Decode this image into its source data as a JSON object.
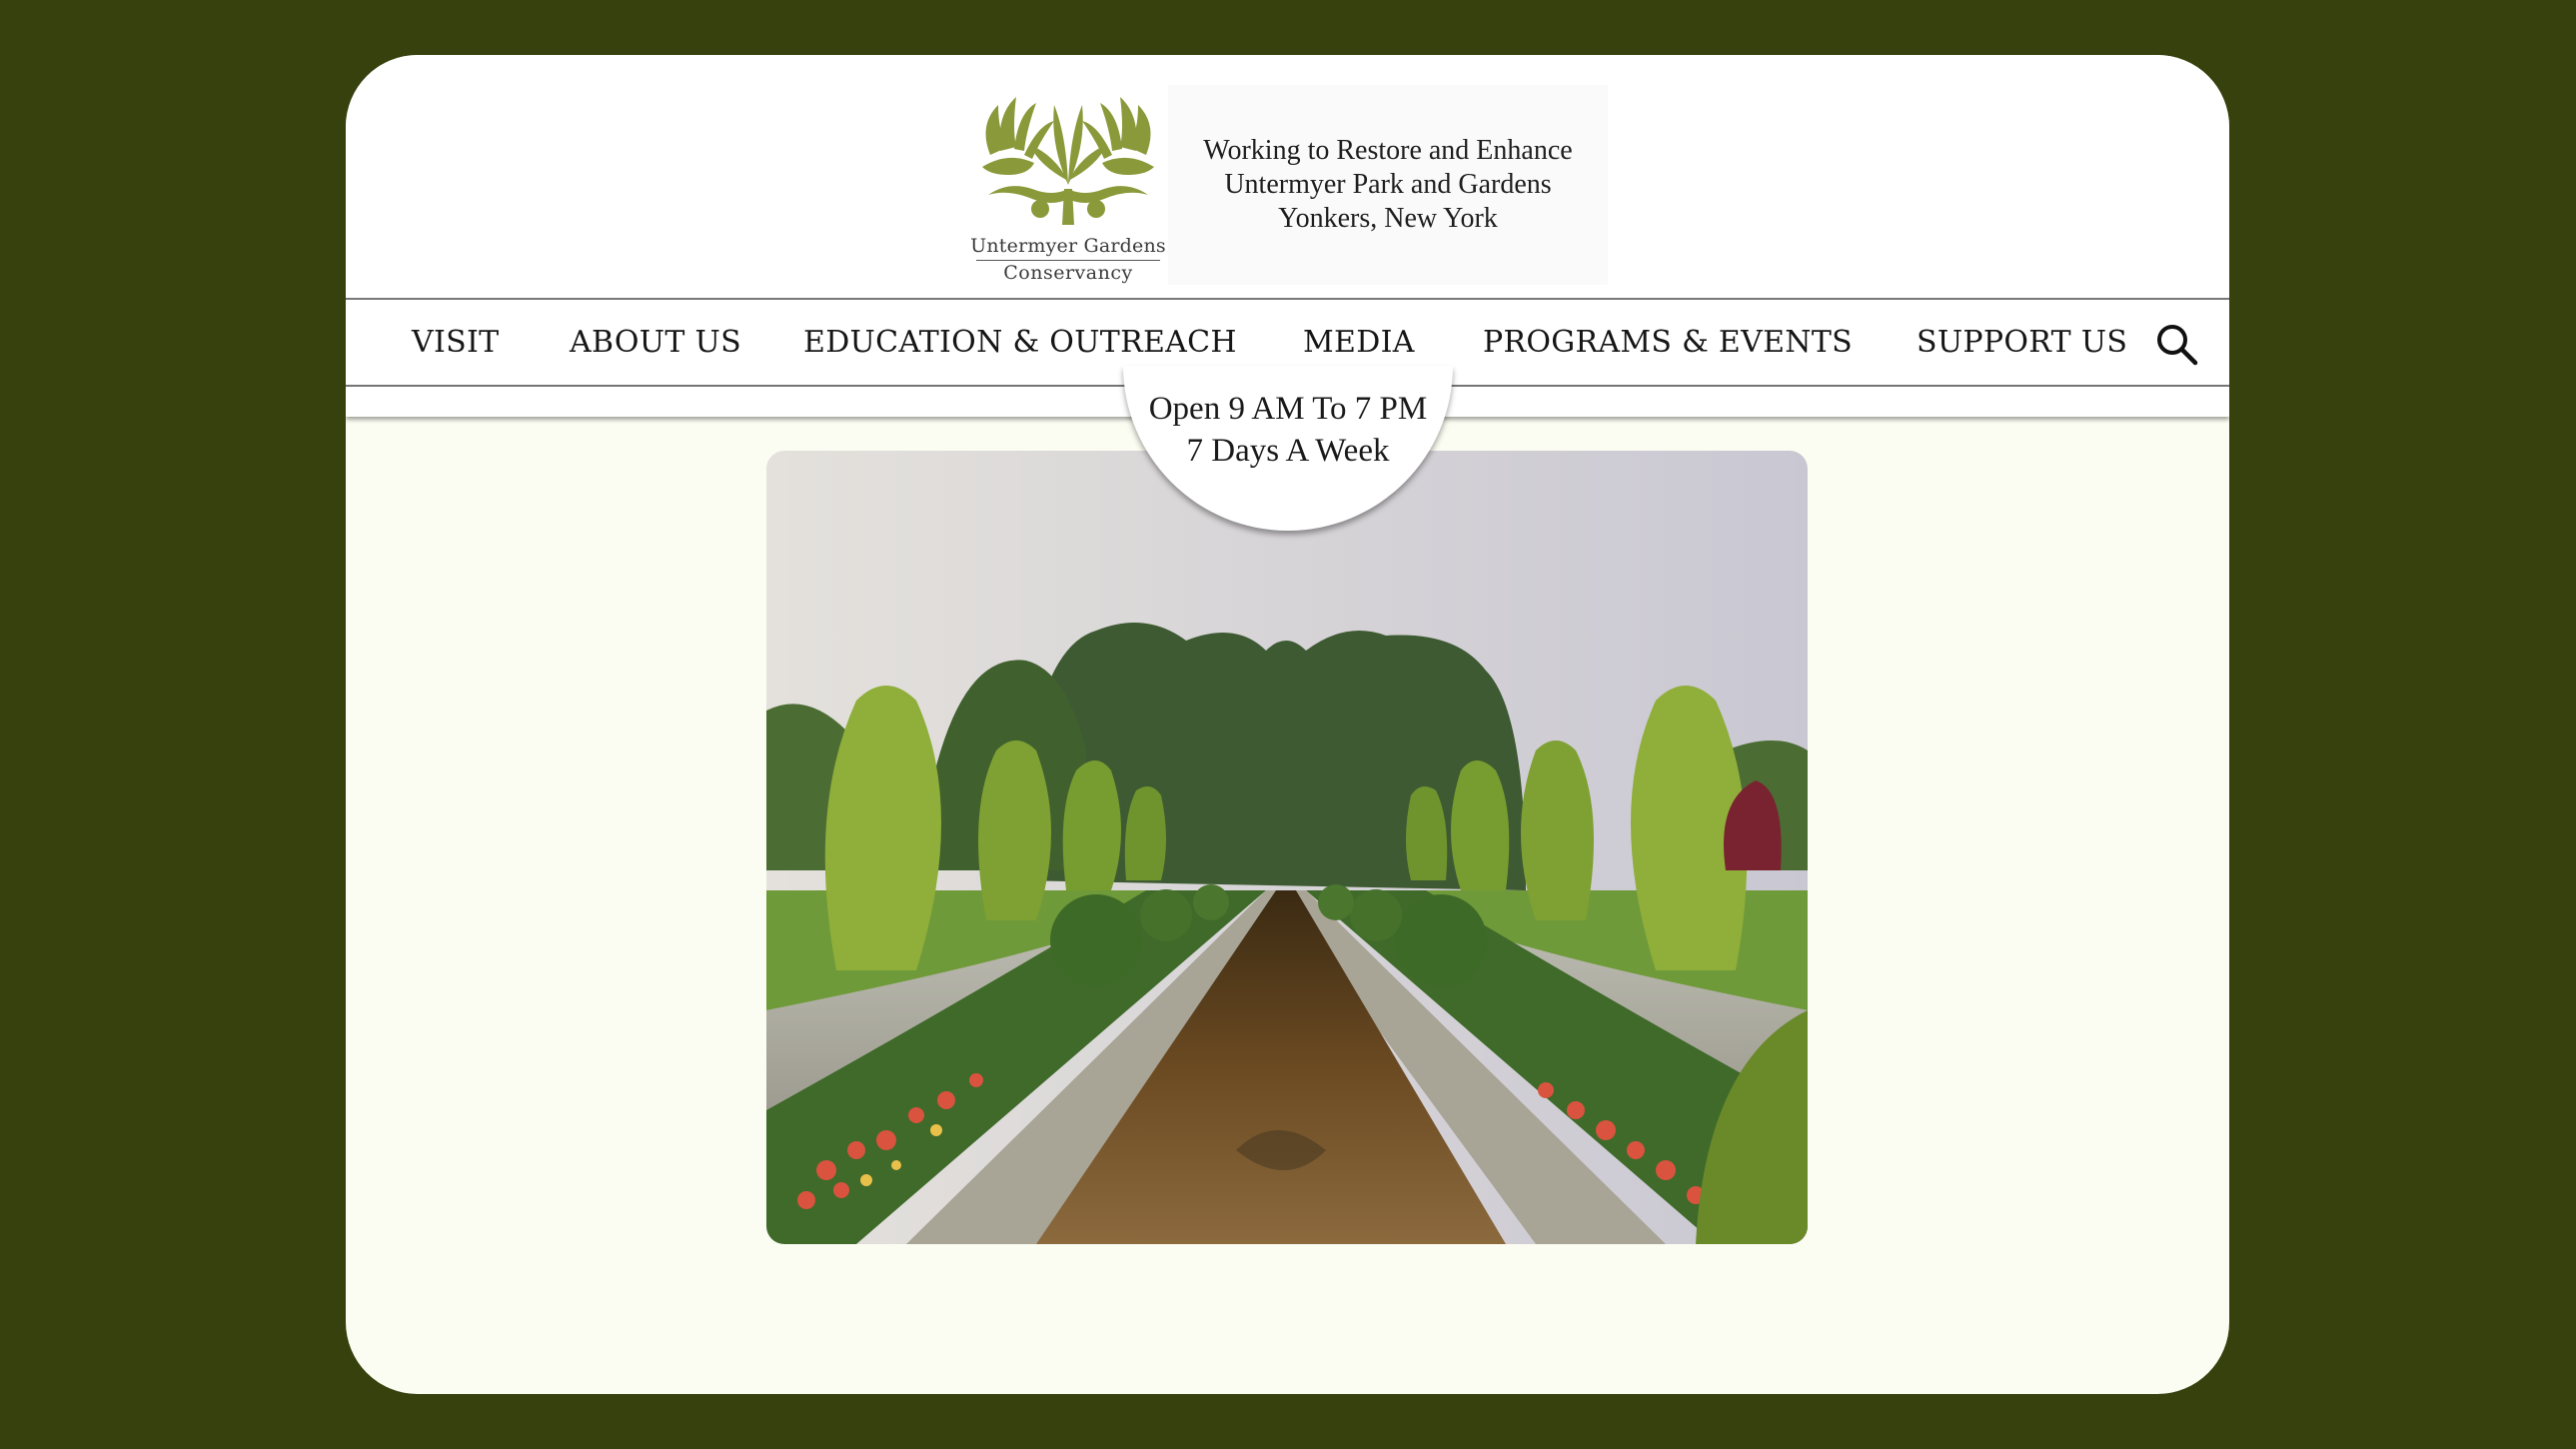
{
  "logo": {
    "line1": "Untermyer Gardens",
    "line2": "Conservancy"
  },
  "tagline": {
    "line1": "Working to Restore and Enhance",
    "line2": "Untermyer Park and Gardens",
    "line3": "Yonkers, New York"
  },
  "nav": {
    "items": [
      {
        "label": "VISIT"
      },
      {
        "label": "ABOUT US"
      },
      {
        "label": "EDUCATION & OUTREACH"
      },
      {
        "label": "MEDIA"
      },
      {
        "label": "PROGRAMS & EVENTS"
      },
      {
        "label": "SUPPORT US"
      }
    ],
    "search_icon": "search-icon"
  },
  "hours": {
    "line1": "Open 9 AM To 7 PM",
    "line2": "7 Days A Week"
  },
  "colors": {
    "page_background": "#37410e",
    "content_background": "#fcfdf2",
    "logo_green": "#8a9a3a"
  }
}
